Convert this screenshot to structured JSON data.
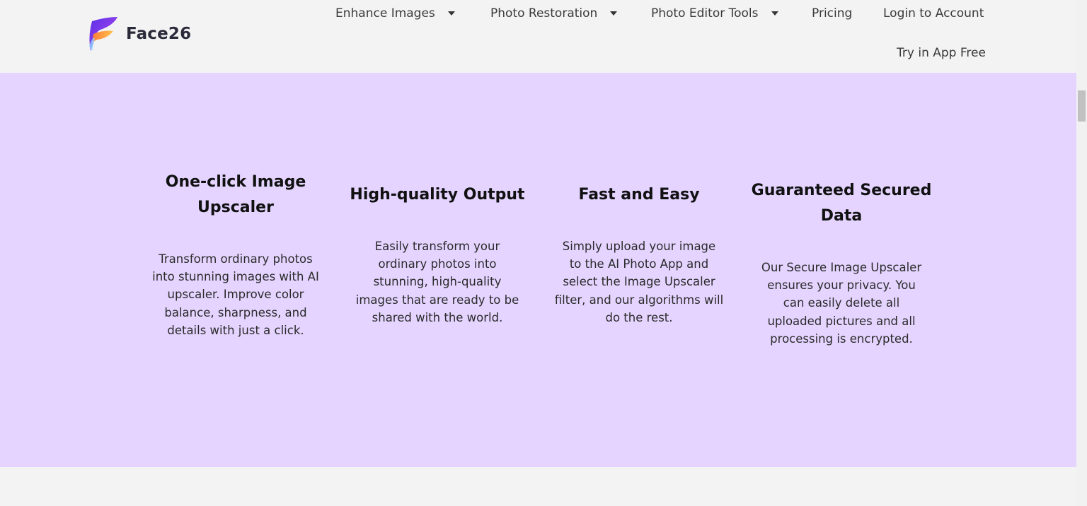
{
  "header": {
    "brand": "Face26",
    "nav": [
      {
        "label": "Enhance Images",
        "dropdown": true
      },
      {
        "label": "Photo Restoration",
        "dropdown": true
      },
      {
        "label": "Photo Editor Tools",
        "dropdown": true
      },
      {
        "label": "Pricing",
        "dropdown": false
      },
      {
        "label": "Login to Account",
        "dropdown": false
      }
    ],
    "cta": "Try in App Free"
  },
  "features": [
    {
      "title_lines": [
        "One-click Image",
        "Upscaler"
      ],
      "desc_lines": [
        "Transform ordinary photos",
        "into stunning images with AI",
        "upscaler. Improve color",
        "balance, sharpness, and",
        "details with just a click."
      ]
    },
    {
      "title_lines": [
        "High-quality Output"
      ],
      "desc_lines": [
        "Easily transform your",
        "ordinary photos into",
        "stunning, high-quality",
        "images that are ready to be",
        "shared with the world."
      ]
    },
    {
      "title_lines": [
        "Fast and Easy"
      ],
      "desc_lines": [
        "Simply upload your image",
        "to the AI Photo App and",
        "select the Image Upscaler",
        "filter, and our algorithms will",
        "do the rest."
      ]
    },
    {
      "title_lines": [
        "Guaranteed Secured",
        "Data"
      ],
      "desc_lines": [
        "Our Secure Image Upscaler",
        "ensures your privacy. You",
        "can easily delete all",
        "uploaded pictures and all",
        "processing is encrypted."
      ]
    }
  ],
  "colors": {
    "section_bg": "#e4d4ff",
    "page_bg": "#f3f3f3",
    "logo_purple": "#7b3cf2",
    "logo_orange": "#ff9a3c"
  }
}
